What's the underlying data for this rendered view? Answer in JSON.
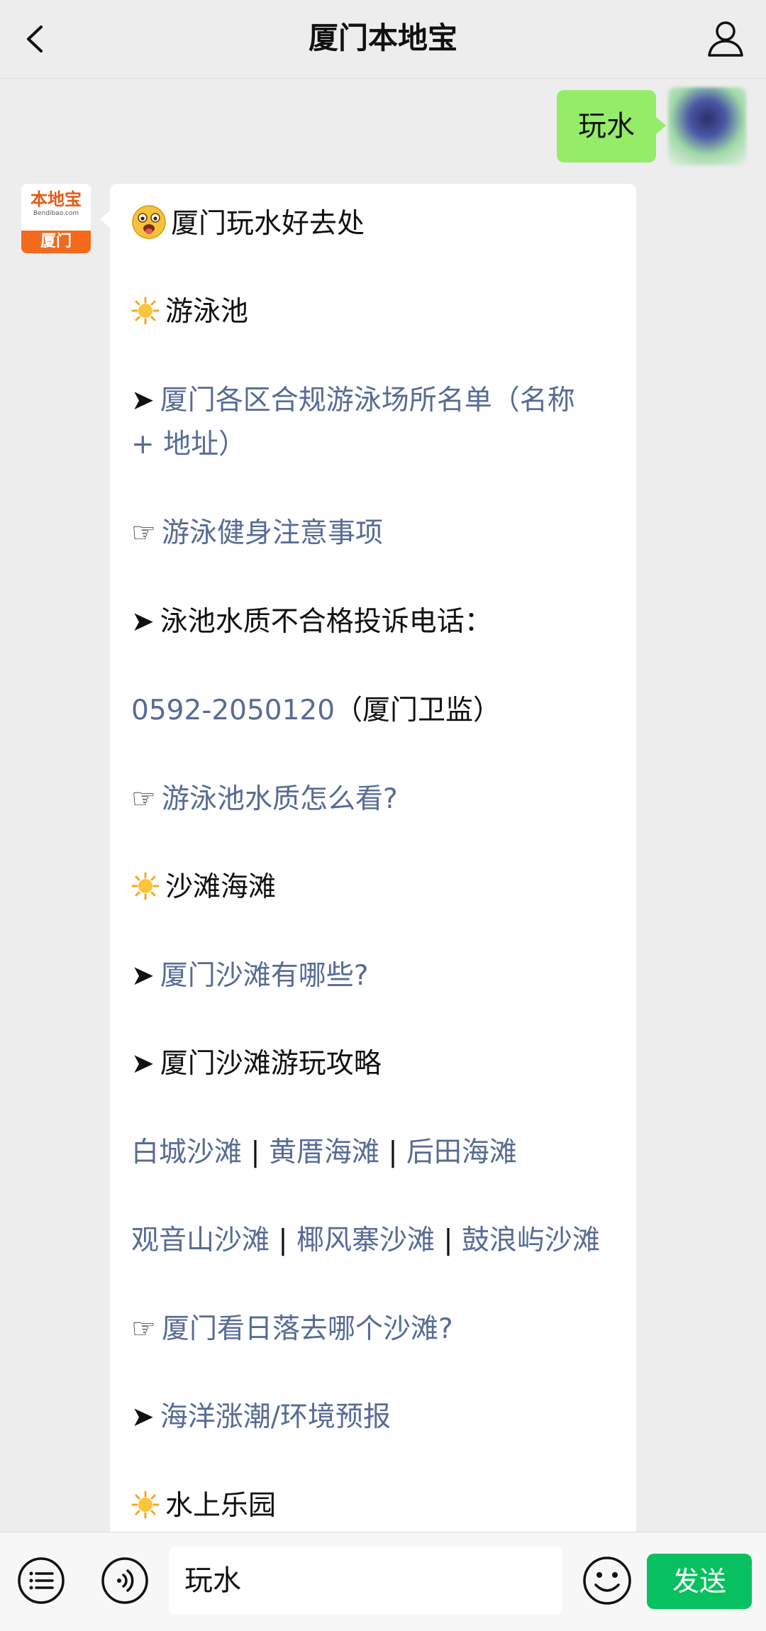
{
  "header": {
    "title": "厦门本地宝"
  },
  "user_message": {
    "text": "玩水"
  },
  "bot": {
    "avatar": {
      "logo_text": "本地宝",
      "logo_sub": "Bendibao.com",
      "city": "厦门"
    },
    "title": "厦门玩水好去处",
    "section_pool": "游泳池",
    "pool_link_1a": "厦门各区合规游泳场所名单（名称",
    "pool_link_1b": "+ 地址）",
    "pool_link_2": "游泳健身注意事项",
    "pool_complaint_label": "泳池水质不合格投诉电话：",
    "pool_phone": "0592-2050120",
    "pool_phone_note": "（厦门卫监）",
    "pool_link_3": "游泳池水质怎么看?",
    "section_beach": "沙滩海滩",
    "beach_link_1": "厦门沙滩有哪些?",
    "beach_guide_label": "厦门沙滩游玩攻略",
    "beaches_row1": [
      "白城沙滩",
      "黄厝海滩",
      "后田海滩"
    ],
    "beaches_row2": [
      "观音山沙滩",
      "椰风寨沙滩",
      "鼓浪屿沙滩"
    ],
    "separator": " | ",
    "beach_link_2": "厦门看日落去哪个沙滩?",
    "beach_link_3": "海洋涨潮/环境预报",
    "section_park": "水上乐园"
  },
  "input_bar": {
    "value": "玩水",
    "send_label": "发送"
  },
  "icons": {
    "back": "chevron-left-icon",
    "profile": "person-icon",
    "menu": "list-menu-icon",
    "voice": "voice-icon",
    "emoji": "smiley-icon",
    "sun": "sun-emoji",
    "face": "tongue-face-emoji"
  },
  "colors": {
    "link": "#576b95",
    "sent_bubble": "#95ec69",
    "send_button": "#07c160",
    "brand": "#f36a1c"
  }
}
